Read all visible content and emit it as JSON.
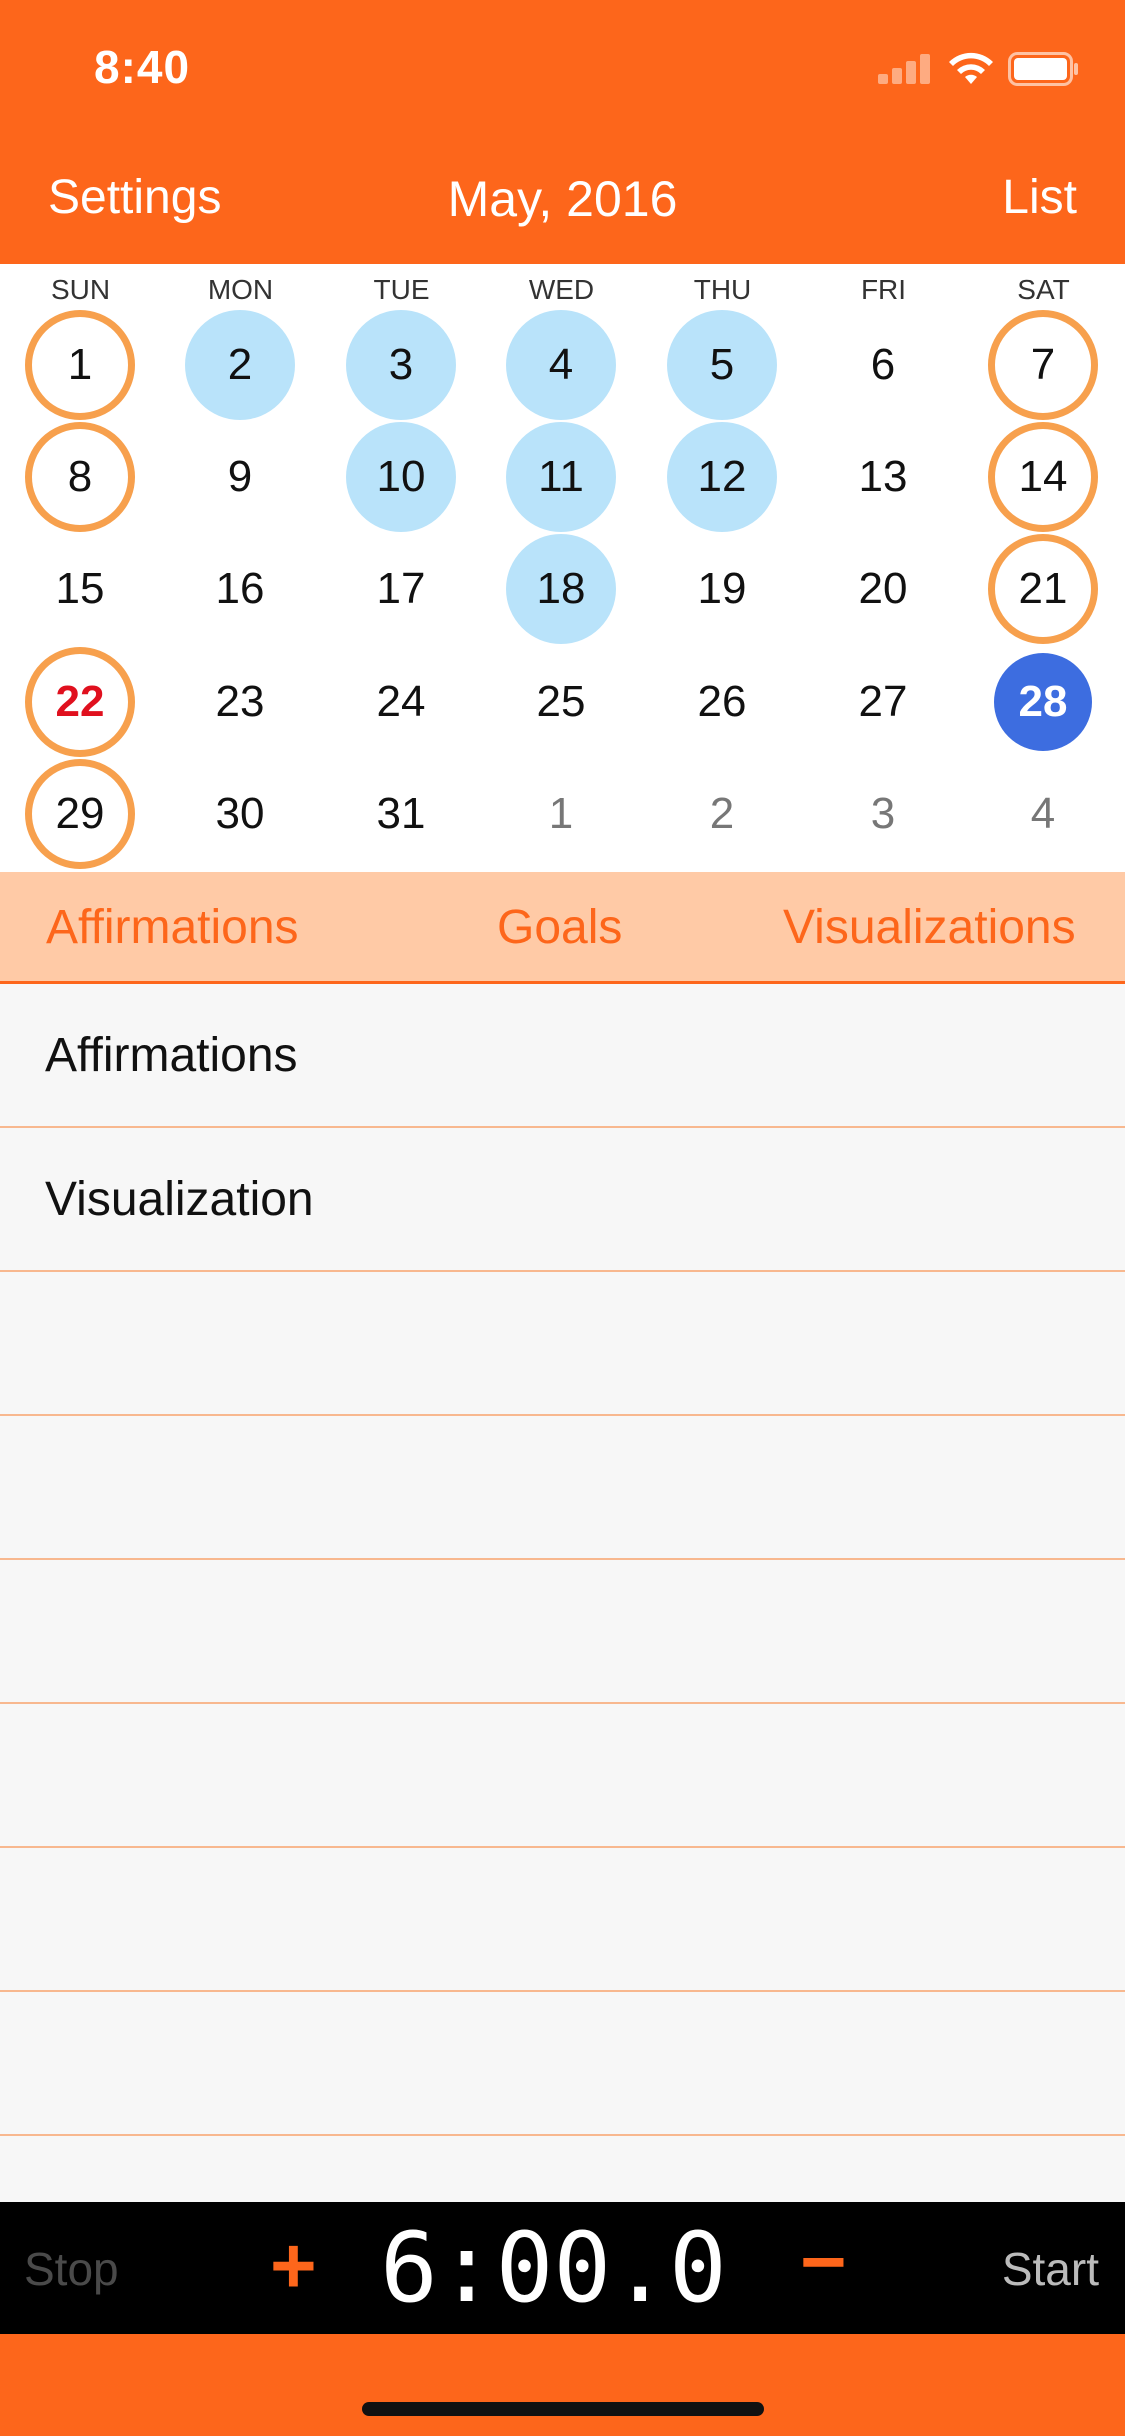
{
  "status": {
    "time": "8:40",
    "signal_icon": "cellular-signal-icon",
    "wifi_icon": "wifi-icon",
    "battery_icon": "battery-icon"
  },
  "nav": {
    "left": "Settings",
    "title": "May, 2016",
    "right": "List"
  },
  "calendar": {
    "weekdays": [
      "SUN",
      "MON",
      "TUE",
      "WED",
      "THU",
      "FRI",
      "SAT"
    ],
    "weeks": [
      [
        {
          "d": "1",
          "s": "ring"
        },
        {
          "d": "2",
          "s": "blue"
        },
        {
          "d": "3",
          "s": "blue"
        },
        {
          "d": "4",
          "s": "blue"
        },
        {
          "d": "5",
          "s": "blue"
        },
        {
          "d": "6",
          "s": ""
        },
        {
          "d": "7",
          "s": "ring"
        }
      ],
      [
        {
          "d": "8",
          "s": "ring"
        },
        {
          "d": "9",
          "s": ""
        },
        {
          "d": "10",
          "s": "blue"
        },
        {
          "d": "11",
          "s": "blue"
        },
        {
          "d": "12",
          "s": "blue"
        },
        {
          "d": "13",
          "s": ""
        },
        {
          "d": "14",
          "s": "ring"
        }
      ],
      [
        {
          "d": "15",
          "s": ""
        },
        {
          "d": "16",
          "s": ""
        },
        {
          "d": "17",
          "s": ""
        },
        {
          "d": "18",
          "s": "blue"
        },
        {
          "d": "19",
          "s": ""
        },
        {
          "d": "20",
          "s": ""
        },
        {
          "d": "21",
          "s": "ring"
        }
      ],
      [
        {
          "d": "22",
          "s": "ring red"
        },
        {
          "d": "23",
          "s": ""
        },
        {
          "d": "24",
          "s": ""
        },
        {
          "d": "25",
          "s": ""
        },
        {
          "d": "26",
          "s": ""
        },
        {
          "d": "27",
          "s": ""
        },
        {
          "d": "28",
          "s": "today"
        }
      ],
      [
        {
          "d": "29",
          "s": "ring"
        },
        {
          "d": "30",
          "s": ""
        },
        {
          "d": "31",
          "s": ""
        },
        {
          "d": "1",
          "s": "dim"
        },
        {
          "d": "2",
          "s": "dim"
        },
        {
          "d": "3",
          "s": "dim"
        },
        {
          "d": "4",
          "s": "dim"
        }
      ]
    ]
  },
  "tabs": [
    "Affirmations",
    "Goals",
    "Visualizations"
  ],
  "list": {
    "items": [
      "Affirmations",
      "Visualization",
      "",
      "",
      "",
      "",
      "",
      ""
    ]
  },
  "timer": {
    "stop": "Stop",
    "plus": "+",
    "value": "6:00.0",
    "minus": "−",
    "start": "Start"
  },
  "colors": {
    "accent": "#fd661b",
    "tab_bg": "#ffcaa6",
    "completed": "#b9e3fa",
    "ring": "#f7a04d",
    "today": "#3d6de0"
  }
}
